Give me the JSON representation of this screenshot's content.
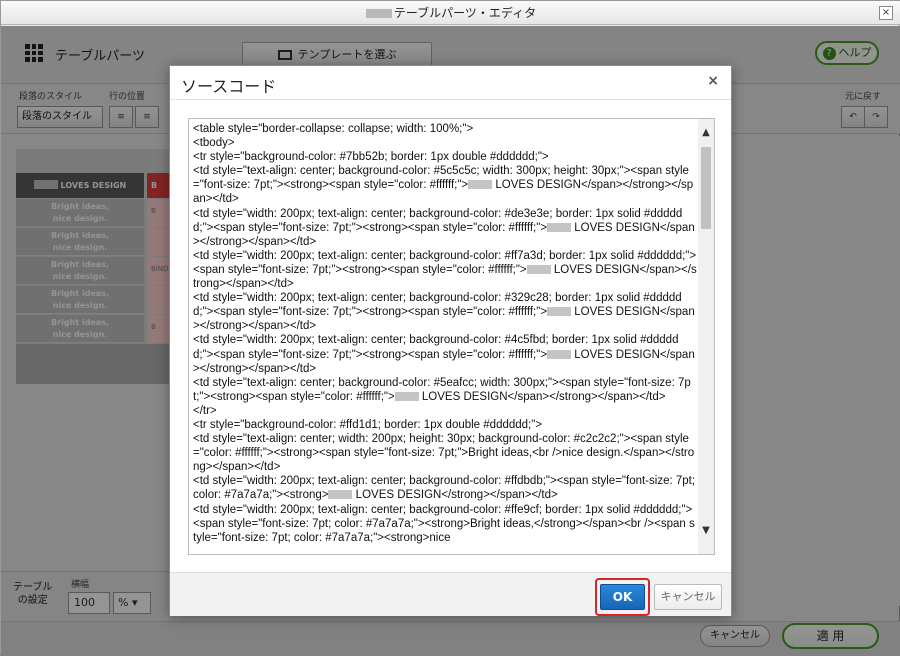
{
  "window": {
    "title_suffix": "テーブルパーツ・エディタ",
    "close_glyph": "×"
  },
  "toolbar": {
    "title": "テーブルパーツ",
    "template_button": "テンプレートを選ぶ",
    "help_button": "ヘルプ"
  },
  "sub_toolbar": {
    "paragraph_style_label": "段落のスタイル",
    "row_position_label": "行の位置",
    "paragraph_style_button": "段落のスタイル",
    "undo_label": "元に戻す"
  },
  "canvas": {
    "header_text": "LOVES DESIGN",
    "header_red_text": "B",
    "cell_lines": [
      "Bright ideas,",
      "nice design."
    ],
    "pink_texts": [
      "B",
      "",
      "BiND",
      "",
      "B"
    ]
  },
  "bottom_settings": {
    "label": "テーブル\nの設定",
    "width_label": "横幅",
    "width_value": "100",
    "unit_value": "%"
  },
  "footer": {
    "cancel": "キャンセル",
    "apply": "適 用"
  },
  "modal": {
    "title": "ソースコード",
    "close_glyph": "×",
    "code_lines": [
      "<table style=\"border-collapse: collapse; width: 100%;\">",
      "<tbody>",
      "<tr style=\"background-color: #7bb52b; border: 1px double #dddddd;\">",
      "<td style=\"text-align: center; background-color: #5c5c5c; width: 300px; height: 30px;\"><span style=\"font-size: 7pt;\"><strong><span style=\"color: #ffffff;\">[[BLUR]] LOVES DESIGN</span></strong></span></td>",
      "<td style=\"width: 200px; text-align: center; background-color: #de3e3e; border: 1px solid #dddddd;\"><span style=\"font-size: 7pt;\"><strong><span style=\"color: #ffffff;\">[[BLUR]] LOVES DESIGN</span></strong></span></td>",
      "<td style=\"width: 200px; text-align: center; background-color: #ff7a3d; border: 1px solid #dddddd;\"><span style=\"font-size: 7pt;\"><strong><span style=\"color: #ffffff;\">[[BLUR]] LOVES DESIGN</span></strong></span></td>",
      "<td style=\"width: 200px; text-align: center; background-color: #329c28; border: 1px solid #dddddd;\"><span style=\"font-size: 7pt;\"><strong><span style=\"color: #ffffff;\">[[BLUR]] LOVES DESIGN</span></strong></span></td>",
      "<td style=\"width: 200px; text-align: center; background-color: #4c5fbd; border: 1px solid #dddddd;\"><span style=\"font-size: 7pt;\"><strong><span style=\"color: #ffffff;\">[[BLUR]] LOVES DESIGN</span></strong></span></td>",
      "<td style=\"text-align: center; background-color: #5eafcc; width: 300px;\"><span style=\"font-size: 7pt;\"><strong><span style=\"color: #ffffff;\">[[BLUR]] LOVES DESIGN</span></strong></span></td>",
      "</tr>",
      "<tr style=\"background-color: #ffd1d1; border: 1px double #dddddd;\">",
      "<td style=\"text-align: center; width: 200px; height: 30px; background-color: #c2c2c2;\"><span style=\"color: #ffffff;\"><strong><span style=\"font-size: 7pt;\">Bright ideas,<br />nice design.</span></strong></span></td>",
      "<td style=\"width: 200px; text-align: center; background-color: #ffdbdb;\"><span style=\"font-size: 7pt; color: #7a7a7a;\"><strong>[[BLUR]] LOVES DESIGN</strong></span></td>",
      "<td style=\"width: 200px; text-align: center; background-color: #ffe9cf; border: 1px solid #dddddd;\"><span style=\"font-size: 7pt; color: #7a7a7a;\"><strong>Bright ideas,</strong></span><br /><span style=\"font-size: 7pt; color: #7a7a7a;\"><strong>nice"
    ],
    "ok_button": "OK",
    "cancel_button": "キャンセル"
  },
  "colors": {
    "ok_blue": "#1a73c8",
    "highlight_red": "#d8232a",
    "help_green": "#4a9a2a"
  }
}
